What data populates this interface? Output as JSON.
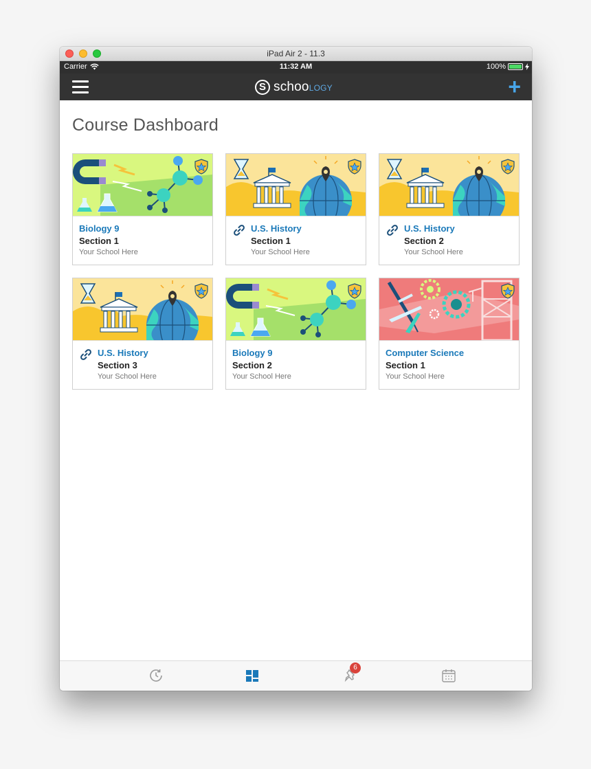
{
  "window": {
    "title": "iPad Air 2 - 11.3"
  },
  "status_bar": {
    "carrier": "Carrier",
    "time": "11:32 AM",
    "battery": "100%"
  },
  "navbar": {
    "logo_main": "schoo",
    "logo_accent": "LOGY",
    "logo_mark": "S"
  },
  "page": {
    "title": "Course Dashboard"
  },
  "courses": [
    {
      "title": "Biology 9",
      "section": "Section 1",
      "school": "Your School Here",
      "linked": false,
      "theme": "biology"
    },
    {
      "title": "U.S. History",
      "section": "Section 1",
      "school": "Your School Here",
      "linked": true,
      "theme": "history"
    },
    {
      "title": "U.S. History",
      "section": "Section 2",
      "school": "Your School Here",
      "linked": true,
      "theme": "history"
    },
    {
      "title": "U.S. History",
      "section": "Section 3",
      "school": "Your School Here",
      "linked": true,
      "theme": "history"
    },
    {
      "title": "Biology 9",
      "section": "Section 2",
      "school": "Your School Here",
      "linked": false,
      "theme": "biology"
    },
    {
      "title": "Computer Science",
      "section": "Section 1",
      "school": "Your School Here",
      "linked": false,
      "theme": "cs"
    }
  ],
  "tab_bar": {
    "tabs": [
      {
        "icon": "recent-activity-icon",
        "active": false
      },
      {
        "icon": "courses-dashboard-icon",
        "active": true
      },
      {
        "icon": "notifications-pin-icon",
        "active": false,
        "badge": "6"
      },
      {
        "icon": "calendar-icon",
        "active": false
      }
    ]
  },
  "colors": {
    "accent": "#1a79b9",
    "navbar": "#333333",
    "plus": "#48a6ea",
    "badge": "#d9433b",
    "biology_bg": "#d9f77f",
    "history_bg": "#fbe49a",
    "cs_bg": "#ef7b7b"
  }
}
